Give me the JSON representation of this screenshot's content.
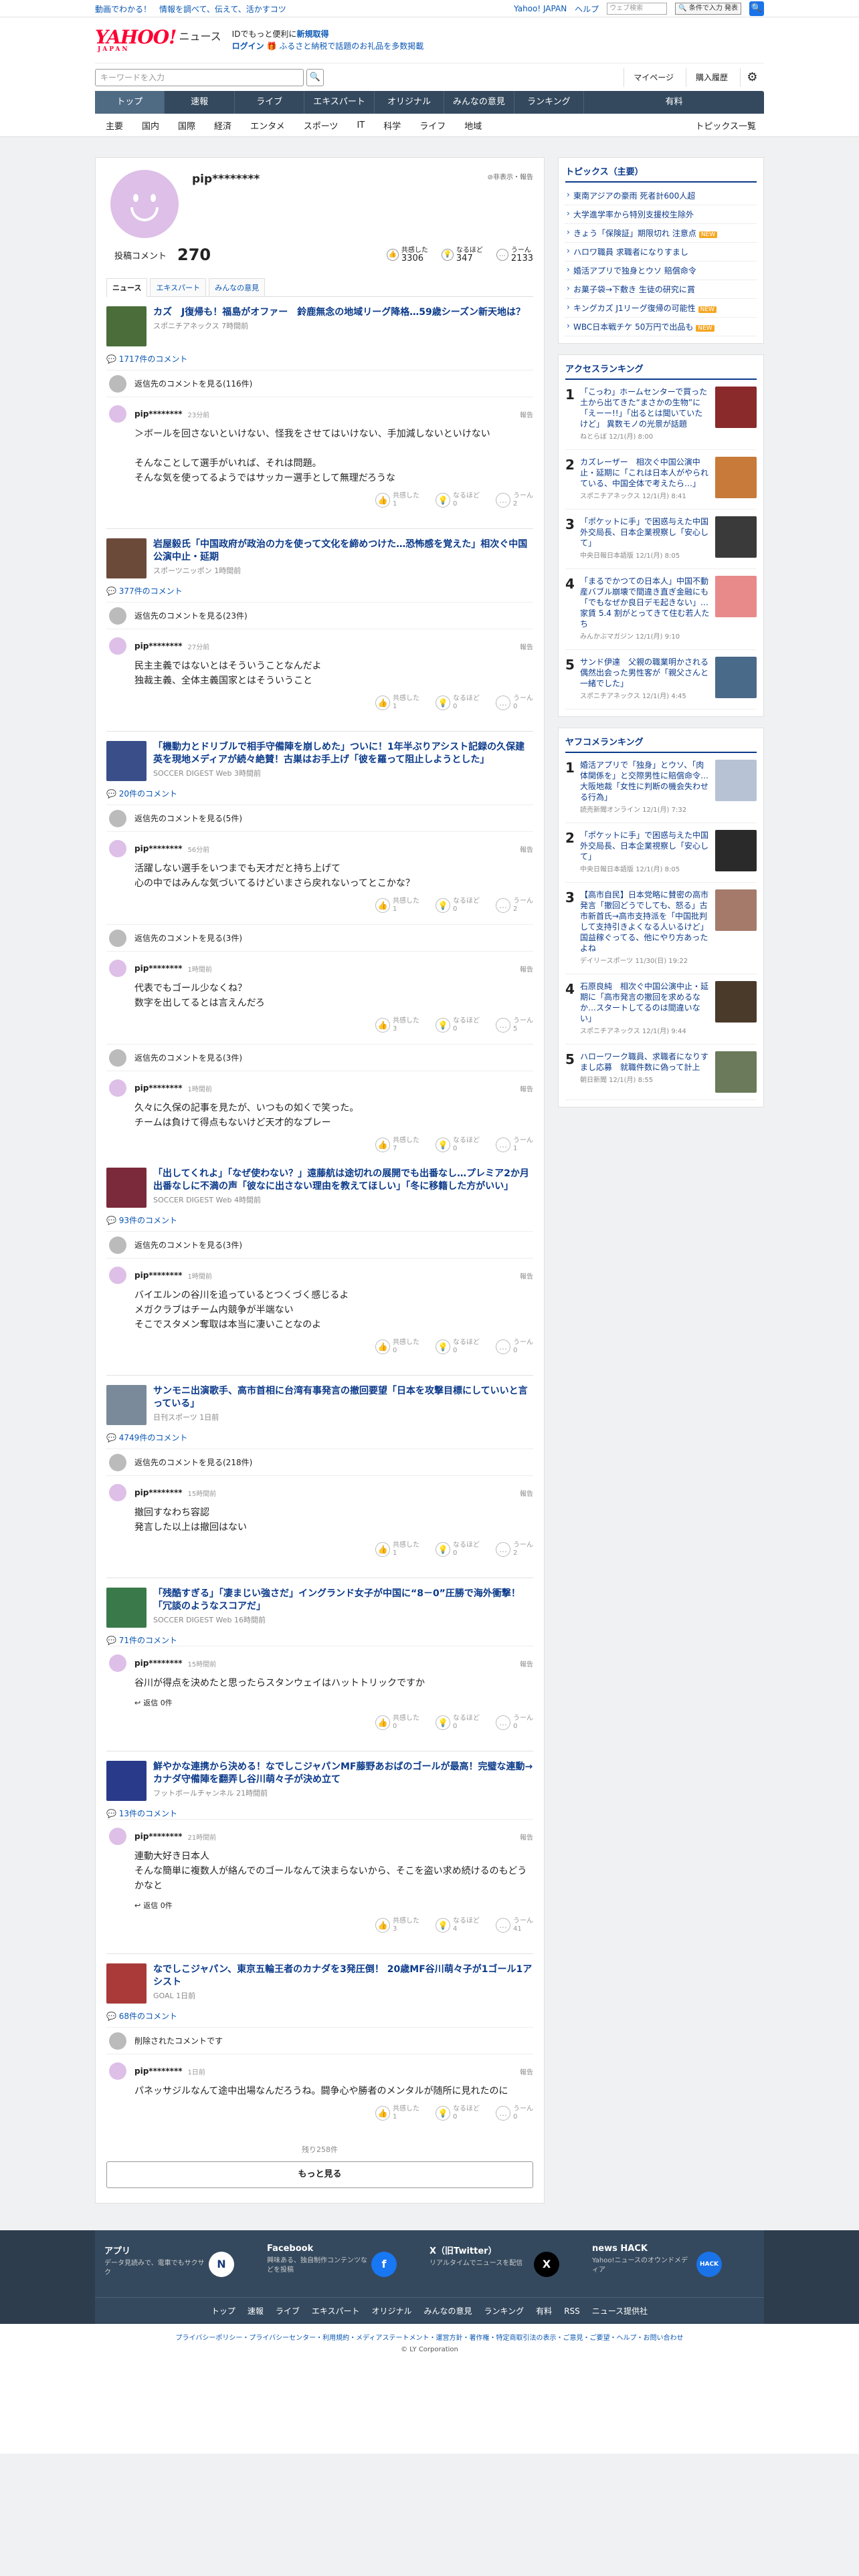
{
  "topbar": {
    "left": "動画でわかる！　情報を調べて、伝えて、活かすコツ",
    "links": [
      "Yahoo! JAPAN",
      "ヘルプ"
    ],
    "search_placeholder": "ウェブ検索",
    "search_button": "🔍 条件で入力 発表"
  },
  "header": {
    "logo": "YAHOO!",
    "logo_sub": "JAPAN",
    "logo_news": "ニュース",
    "promo1_pre": "IDでもっと便利に",
    "promo1_link": "新規取得",
    "promo2_link": "ログイン",
    "promo2_text": "ふるさと納税で話題のお礼品を多数掲載"
  },
  "search": {
    "placeholder": "キーワードを入力",
    "mypage": "マイページ",
    "history": "購入履歴"
  },
  "nav": [
    "トップ",
    "速報",
    "ライブ",
    "エキスパート",
    "オリジナル",
    "みんなの意見",
    "ランキング",
    "有料"
  ],
  "subnav": [
    "主要",
    "国内",
    "国際",
    "経済",
    "エンタメ",
    "スポーツ",
    "IT",
    "科学",
    "ライフ",
    "地域"
  ],
  "subnav_all": "トピックス一覧",
  "profile": {
    "name": "pip********",
    "hide": "非表示・報告",
    "total_label": "投稿コメント",
    "total": "270",
    "stats": [
      {
        "label": "共感した",
        "value": "3306"
      },
      {
        "label": "なるほど",
        "value": "347"
      },
      {
        "label": "うーん",
        "value": "2133"
      }
    ]
  },
  "tabs": [
    "ニュース",
    "エキスパート",
    "みんなの意見"
  ],
  "articles": [
    {
      "title": "カズ　J復帰も！福島がオファー　鈴鹿無念の地域リーグ降格…59歳シーズン新天地は？",
      "source": "スポニチアネックス 7時間前",
      "count": "1717件のコメント",
      "showmore": "返信先のコメントを見る(116件)",
      "comments": [
        {
          "time": "23分前",
          "text": "＞ボールを回さないといけない、怪我をさせてはいけない、手加減しないといけない\n\nそんなことして選手がいれば、それは問題。\nそんな気を使ってるようではサッカー選手として無理だろうな",
          "r": [
            "共感した\n1",
            "なるほど\n0",
            "うーん\n2"
          ]
        }
      ]
    },
    {
      "title": "岩屋毅氏「中国政府が政治の力を使って文化を締めつけた…恐怖感を覚えた」相次ぐ中国公演中止・延期",
      "source": "スポーツニッポン 1時間前",
      "count": "377件のコメント",
      "showmore": "返信先のコメントを見る(23件)",
      "comments": [
        {
          "time": "27分前",
          "text": "民主主義ではないとはそういうことなんだよ\n独裁主義、全体主義国家とはそういうこと",
          "r": [
            "共感した\n1",
            "なるほど\n0",
            "うーん\n0"
          ]
        }
      ]
    },
    {
      "title": "「機動力とドリブルで相手守備陣を崩しめた」ついに！1年半ぶりアシスト記録の久保建英を現地メディアが続々絶賛！古巣はお手上げ「彼を羅って阻止しようとした」",
      "source": "SOCCER DIGEST Web 3時間前",
      "count": "20件のコメント",
      "showmore": "返信先のコメントを見る(5件)",
      "comments": [
        {
          "time": "56分前",
          "text": "活躍しない選手をいつまでも天才だと持ち上げて\n心の中ではみんな気づいてるけどいまさら戻れないってとこかな？",
          "r": [
            "共感した\n1",
            "なるほど\n0",
            "うーん\n2"
          ]
        }
      ]
    },
    {
      "title": "",
      "source": "",
      "count": "",
      "showmore": "返信先のコメントを見る(3件)",
      "comments": [
        {
          "time": "1時間前",
          "text": "代表でもゴール少なくね？\n数字を出してるとは言えんだろ",
          "r": [
            "共感した\n3",
            "なるほど\n0",
            "うーん\n5"
          ]
        }
      ]
    },
    {
      "title": "",
      "source": "",
      "count": "",
      "showmore": "返信先のコメントを見る(3件)",
      "comments": [
        {
          "time": "1時間前",
          "text": "久々に久保の記事を見たが、いつもの如くで笑った。\nチームは負けて得点もないけど天才的なプレー",
          "r": [
            "共感した\n7",
            "なるほど\n0",
            "うーん\n1"
          ]
        }
      ]
    },
    {
      "title": "「出してくれよ」「なぜ使わない？」遠藤航は途切れの展開でも出番なし…プレミア2か月出番なしに不満の声「彼なに出さない理由を教えてほしい」「冬に移籍した方がいい」",
      "source": "SOCCER DIGEST Web 4時間前",
      "count": "93件のコメント",
      "showmore": "返信先のコメントを見る(3件)",
      "comments": [
        {
          "time": "1時間前",
          "text": "バイエルンの谷川を追っているとつくづく感じるよ\nメガクラブはチーム内競争が半端ない\nそこでスタメン奪取は本当に凄いことなのよ",
          "r": [
            "共感した\n0",
            "なるほど\n0",
            "うーん\n0"
          ]
        }
      ]
    },
    {
      "title": "サンモニ出演歌手、高市首相に台湾有事発言の撤回要望「日本を攻撃目標にしていいと言っている」",
      "source": "日刊スポーツ 1日前",
      "count": "4749件のコメント",
      "showmore": "返信先のコメントを見る(218件)",
      "comments": [
        {
          "time": "15時間前",
          "text": "撤回すなわち容認\n発言した以上は撤回はない",
          "r": [
            "共感した\n1",
            "なるほど\n0",
            "うーん\n2"
          ]
        }
      ]
    },
    {
      "title": "「残酷すぎる」「凄まじい強さだ」イングランド女子が中国に“8－0”圧勝で海外衝撃！「冗談のようなスコアだ」",
      "source": "SOCCER DIGEST Web 16時間前",
      "count": "71件のコメント",
      "showmore": "",
      "comments": [
        {
          "time": "15時間前",
          "text": "谷川が得点を決めたと思ったらスタンウェイはハットトリックですか",
          "r": [
            "共感した\n0",
            "なるほど\n0",
            "うーん\n0"
          ],
          "reply": "返信 0件"
        }
      ]
    },
    {
      "title": "鮮やかな連携から決める！なでしこジャパンMF藤野あおばのゴールが最高！完璧な連動→カナダ守備陣を翻弄し谷川萌々子が決め立て",
      "source": "フットボールチャンネル 21時間前",
      "count": "13件のコメント",
      "showmore": "",
      "comments": [
        {
          "time": "21時間前",
          "text": "連動大好き日本人\nそんな簡単に複数人が絡んでのゴールなんて決まらないから、そこを盗い求め続けるのもどうかなと",
          "r": [
            "共感した\n3",
            "なるほど\n4",
            "うーん\n41"
          ],
          "reply": "返信 0件"
        }
      ]
    },
    {
      "title": "なでしこジャパン、東京五輪王者のカナダを3発圧倒！ 20歳MF谷川萌々子が1ゴール1アシスト",
      "source": "GOAL 1日前",
      "count": "68件のコメント",
      "showmore": "削除されたコメントです",
      "comments": [
        {
          "time": "1日前",
          "text": "パネッサジルなんて途中出場なんだろうね。闘争心や勝者のメンタルが随所に見れたのに",
          "r": [
            "共感した\n1",
            "なるほど\n0",
            "うーん\n0"
          ]
        }
      ]
    }
  ],
  "commenter": "pip********",
  "report": "報告",
  "rest": "残り258件",
  "more": "もっと見る",
  "side": {
    "topics_title": "トピックス（主要）",
    "topics": [
      "東南アジアの豪雨 死者計600人超",
      "大学進学率から特別支援校生除外",
      "きょう「保険証」期限切れ 注意点",
      "ハロワ職員 求職者になりすまし",
      "婚活アプリで独身とウソ 賠償命令",
      "お菓子袋→下敷き 生徒の研究に賞",
      "キングカズ J1リーグ復帰の可能性",
      "WBC日本戦チケ 50万円で出品も"
    ],
    "access_title": "アクセスランキング",
    "access": [
      {
        "n": "1",
        "t": "「こっわ」ホームセンターで買った土から出てきた“まさかの生物”に「えーー!!」「出るとは聞いていたけど」 異数モノの光景が話題",
        "s": "ねとらぼ 12/1(月) 8:00"
      },
      {
        "n": "2",
        "t": "カズレーザー　相次ぐ中国公演中止・延期に「これは日本人がやられている、中国全体で考えたら…」",
        "s": "スポニチアネックス 12/1(月) 8:41"
      },
      {
        "n": "3",
        "t": "「ポケットに手」で困惑与えた中国外交局長、日本企業視察し「安心して」",
        "s": "中央日報日本語版 12/1(月) 8:05"
      },
      {
        "n": "4",
        "t": "「まるでかつての日本人」中国不動産バブル崩壊で間違き直ぎ金融にも「でもなぜか良日デモ起きない」…家賃 5.4 割がとってきて住む若人たち",
        "s": "みんかぶマガジン 12/1(月) 9:10"
      },
      {
        "n": "5",
        "t": "サンド伊達　父親の職業明かされる　偶然出会った男性客が「親父さんと一緒でした」",
        "s": "スポニチアネックス 12/1(月) 4:45"
      }
    ],
    "yahoo_title": "ヤフコメランキング",
    "yahoo": [
      {
        "n": "1",
        "t": "婚活アプリで「独身」とウソ、「肉体関係を」と交際男性に賠償命令…大阪地裁「女性に判断の機会失わせる行為」",
        "s": "読売新聞オンライン 12/1(月) 7:32"
      },
      {
        "n": "2",
        "t": "「ポケットに手」で困惑与えた中国外交局長、日本企業視察し「安心して」",
        "s": "中央日報日本語版 12/1(月) 8:05"
      },
      {
        "n": "3",
        "t": "【高市自民】日本党略に賛密の高市発言「撤回どうでしても、怒る」古市新首氏→高市支持派を「中国批判して支持引きよくなる人いるけど」国益稼ぐってる、他にやり方あったよね",
        "s": "デイリースポーツ 11/30(日) 19:22"
      },
      {
        "n": "4",
        "t": "石原良純　相次ぐ中国公演中止・延期に「高市発言の撤回を求めるなか…スタートしてるのは間違いない」",
        "s": "スポニチアネックス 12/1(月) 9:44"
      },
      {
        "n": "5",
        "t": "ハローワーク職員、求職者になりすまし応募　就職件数に偽って計上",
        "s": "朝日新聞 12/1(月) 8:55"
      }
    ]
  },
  "footer": {
    "blocks": [
      {
        "h": "アプリ",
        "p": "データ見読みで、電車でもサクサク",
        "ic": "N"
      },
      {
        "h": "Facebook",
        "p": "興味ある、独自制作コンテンツなどを投稿",
        "ic": "f"
      },
      {
        "h": "X（旧Twitter）",
        "p": "リアルタイムでニュースを配信",
        "ic": "X"
      },
      {
        "h": "news HACK",
        "p": "Yahoo!ニュースのオウンドメディア",
        "ic": "HACK"
      }
    ],
    "nav": [
      "トップ",
      "速報",
      "ライブ",
      "エキスパート",
      "オリジナル",
      "みんなの意見",
      "ランキング",
      "有料",
      "RSS",
      "ニュース提供社"
    ],
    "links": "プライバシーポリシー・プライバシーセンター・利用規約・メディアステートメント・運営方針・著作権・特定商取引法の表示・ご意見・ご要望・ヘルプ・お問い合わせ",
    "copy": "© LY Corporation"
  }
}
